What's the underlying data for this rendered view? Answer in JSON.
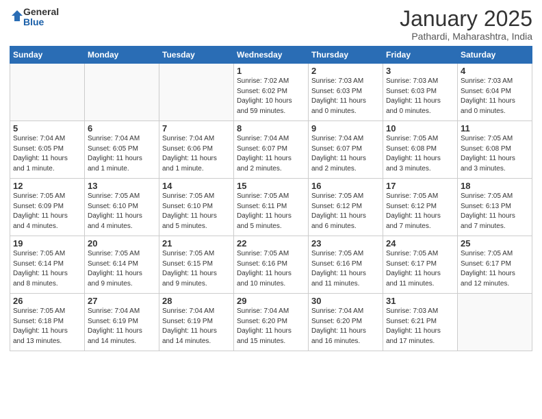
{
  "logo": {
    "general": "General",
    "blue": "Blue"
  },
  "header": {
    "month": "January 2025",
    "location": "Pathardi, Maharashtra, India"
  },
  "days_of_week": [
    "Sunday",
    "Monday",
    "Tuesday",
    "Wednesday",
    "Thursday",
    "Friday",
    "Saturday"
  ],
  "weeks": [
    [
      {
        "day": "",
        "info": ""
      },
      {
        "day": "",
        "info": ""
      },
      {
        "day": "",
        "info": ""
      },
      {
        "day": "1",
        "info": "Sunrise: 7:02 AM\nSunset: 6:02 PM\nDaylight: 10 hours\nand 59 minutes."
      },
      {
        "day": "2",
        "info": "Sunrise: 7:03 AM\nSunset: 6:03 PM\nDaylight: 11 hours\nand 0 minutes."
      },
      {
        "day": "3",
        "info": "Sunrise: 7:03 AM\nSunset: 6:03 PM\nDaylight: 11 hours\nand 0 minutes."
      },
      {
        "day": "4",
        "info": "Sunrise: 7:03 AM\nSunset: 6:04 PM\nDaylight: 11 hours\nand 0 minutes."
      }
    ],
    [
      {
        "day": "5",
        "info": "Sunrise: 7:04 AM\nSunset: 6:05 PM\nDaylight: 11 hours\nand 1 minute."
      },
      {
        "day": "6",
        "info": "Sunrise: 7:04 AM\nSunset: 6:05 PM\nDaylight: 11 hours\nand 1 minute."
      },
      {
        "day": "7",
        "info": "Sunrise: 7:04 AM\nSunset: 6:06 PM\nDaylight: 11 hours\nand 1 minute."
      },
      {
        "day": "8",
        "info": "Sunrise: 7:04 AM\nSunset: 6:07 PM\nDaylight: 11 hours\nand 2 minutes."
      },
      {
        "day": "9",
        "info": "Sunrise: 7:04 AM\nSunset: 6:07 PM\nDaylight: 11 hours\nand 2 minutes."
      },
      {
        "day": "10",
        "info": "Sunrise: 7:05 AM\nSunset: 6:08 PM\nDaylight: 11 hours\nand 3 minutes."
      },
      {
        "day": "11",
        "info": "Sunrise: 7:05 AM\nSunset: 6:08 PM\nDaylight: 11 hours\nand 3 minutes."
      }
    ],
    [
      {
        "day": "12",
        "info": "Sunrise: 7:05 AM\nSunset: 6:09 PM\nDaylight: 11 hours\nand 4 minutes."
      },
      {
        "day": "13",
        "info": "Sunrise: 7:05 AM\nSunset: 6:10 PM\nDaylight: 11 hours\nand 4 minutes."
      },
      {
        "day": "14",
        "info": "Sunrise: 7:05 AM\nSunset: 6:10 PM\nDaylight: 11 hours\nand 5 minutes."
      },
      {
        "day": "15",
        "info": "Sunrise: 7:05 AM\nSunset: 6:11 PM\nDaylight: 11 hours\nand 5 minutes."
      },
      {
        "day": "16",
        "info": "Sunrise: 7:05 AM\nSunset: 6:12 PM\nDaylight: 11 hours\nand 6 minutes."
      },
      {
        "day": "17",
        "info": "Sunrise: 7:05 AM\nSunset: 6:12 PM\nDaylight: 11 hours\nand 7 minutes."
      },
      {
        "day": "18",
        "info": "Sunrise: 7:05 AM\nSunset: 6:13 PM\nDaylight: 11 hours\nand 7 minutes."
      }
    ],
    [
      {
        "day": "19",
        "info": "Sunrise: 7:05 AM\nSunset: 6:14 PM\nDaylight: 11 hours\nand 8 minutes."
      },
      {
        "day": "20",
        "info": "Sunrise: 7:05 AM\nSunset: 6:14 PM\nDaylight: 11 hours\nand 9 minutes."
      },
      {
        "day": "21",
        "info": "Sunrise: 7:05 AM\nSunset: 6:15 PM\nDaylight: 11 hours\nand 9 minutes."
      },
      {
        "day": "22",
        "info": "Sunrise: 7:05 AM\nSunset: 6:16 PM\nDaylight: 11 hours\nand 10 minutes."
      },
      {
        "day": "23",
        "info": "Sunrise: 7:05 AM\nSunset: 6:16 PM\nDaylight: 11 hours\nand 11 minutes."
      },
      {
        "day": "24",
        "info": "Sunrise: 7:05 AM\nSunset: 6:17 PM\nDaylight: 11 hours\nand 11 minutes."
      },
      {
        "day": "25",
        "info": "Sunrise: 7:05 AM\nSunset: 6:17 PM\nDaylight: 11 hours\nand 12 minutes."
      }
    ],
    [
      {
        "day": "26",
        "info": "Sunrise: 7:05 AM\nSunset: 6:18 PM\nDaylight: 11 hours\nand 13 minutes."
      },
      {
        "day": "27",
        "info": "Sunrise: 7:04 AM\nSunset: 6:19 PM\nDaylight: 11 hours\nand 14 minutes."
      },
      {
        "day": "28",
        "info": "Sunrise: 7:04 AM\nSunset: 6:19 PM\nDaylight: 11 hours\nand 14 minutes."
      },
      {
        "day": "29",
        "info": "Sunrise: 7:04 AM\nSunset: 6:20 PM\nDaylight: 11 hours\nand 15 minutes."
      },
      {
        "day": "30",
        "info": "Sunrise: 7:04 AM\nSunset: 6:20 PM\nDaylight: 11 hours\nand 16 minutes."
      },
      {
        "day": "31",
        "info": "Sunrise: 7:03 AM\nSunset: 6:21 PM\nDaylight: 11 hours\nand 17 minutes."
      },
      {
        "day": "",
        "info": ""
      }
    ]
  ]
}
